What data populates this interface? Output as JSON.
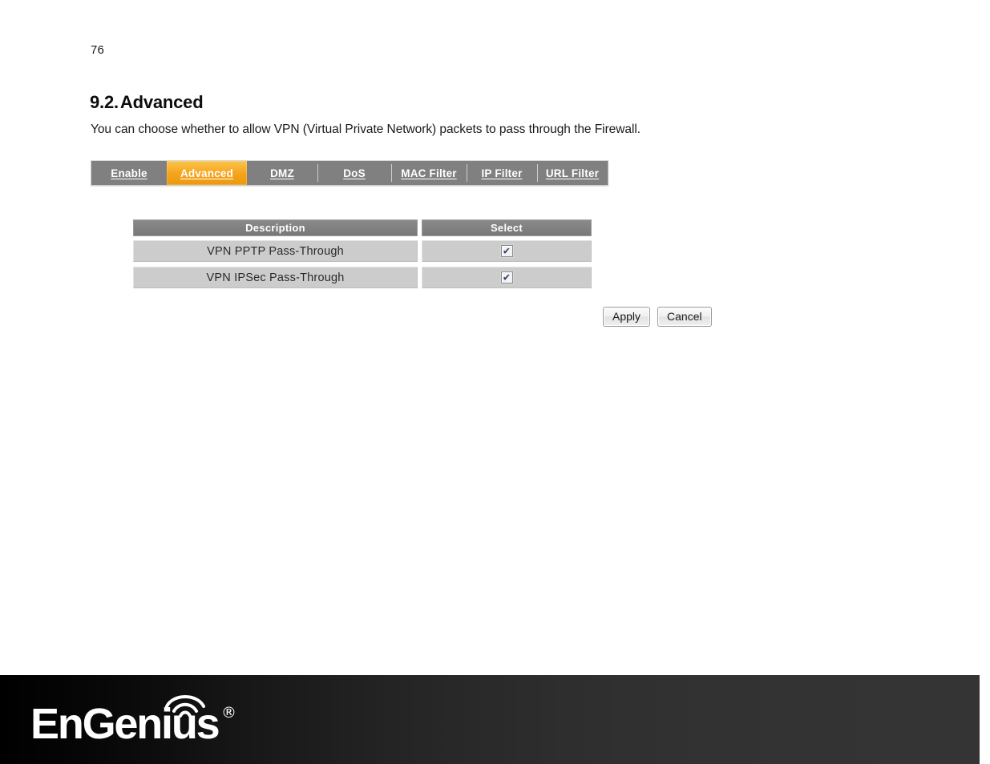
{
  "page": {
    "number": "76",
    "heading_number": "9.2.",
    "heading_title": "Advanced",
    "intro": "You can choose whether to allow VPN (Virtual Private Network) packets to pass through the Firewall."
  },
  "tabs": [
    {
      "label": "Enable",
      "active": false
    },
    {
      "label": "Advanced",
      "active": true
    },
    {
      "label": "DMZ",
      "active": false
    },
    {
      "label": "DoS",
      "active": false
    },
    {
      "label": "MAC Filter",
      "active": false
    },
    {
      "label": "IP Filter",
      "active": false
    },
    {
      "label": "URL Filter",
      "active": false
    }
  ],
  "table": {
    "headers": {
      "description": "Description",
      "select": "Select"
    },
    "rows": [
      {
        "description": "VPN PPTP Pass-Through",
        "checked": true,
        "check_glyph": "✔"
      },
      {
        "description": "VPN IPSec Pass-Through",
        "checked": true,
        "check_glyph": "✔"
      }
    ]
  },
  "actions": {
    "apply_label": "Apply",
    "cancel_label": "Cancel"
  },
  "footer": {
    "brand": "EnGenius",
    "registered_mark": "®",
    "wifi_icon": "wifi-arcs-icon"
  },
  "colors": {
    "tab_bar_background": "#808080",
    "tab_active_background": "#f5a31a",
    "table_header_background": "#7c7c7c",
    "table_row_background": "#cccccc",
    "footer_gradient_start": "#000000",
    "footer_gradient_end": "#343434"
  }
}
